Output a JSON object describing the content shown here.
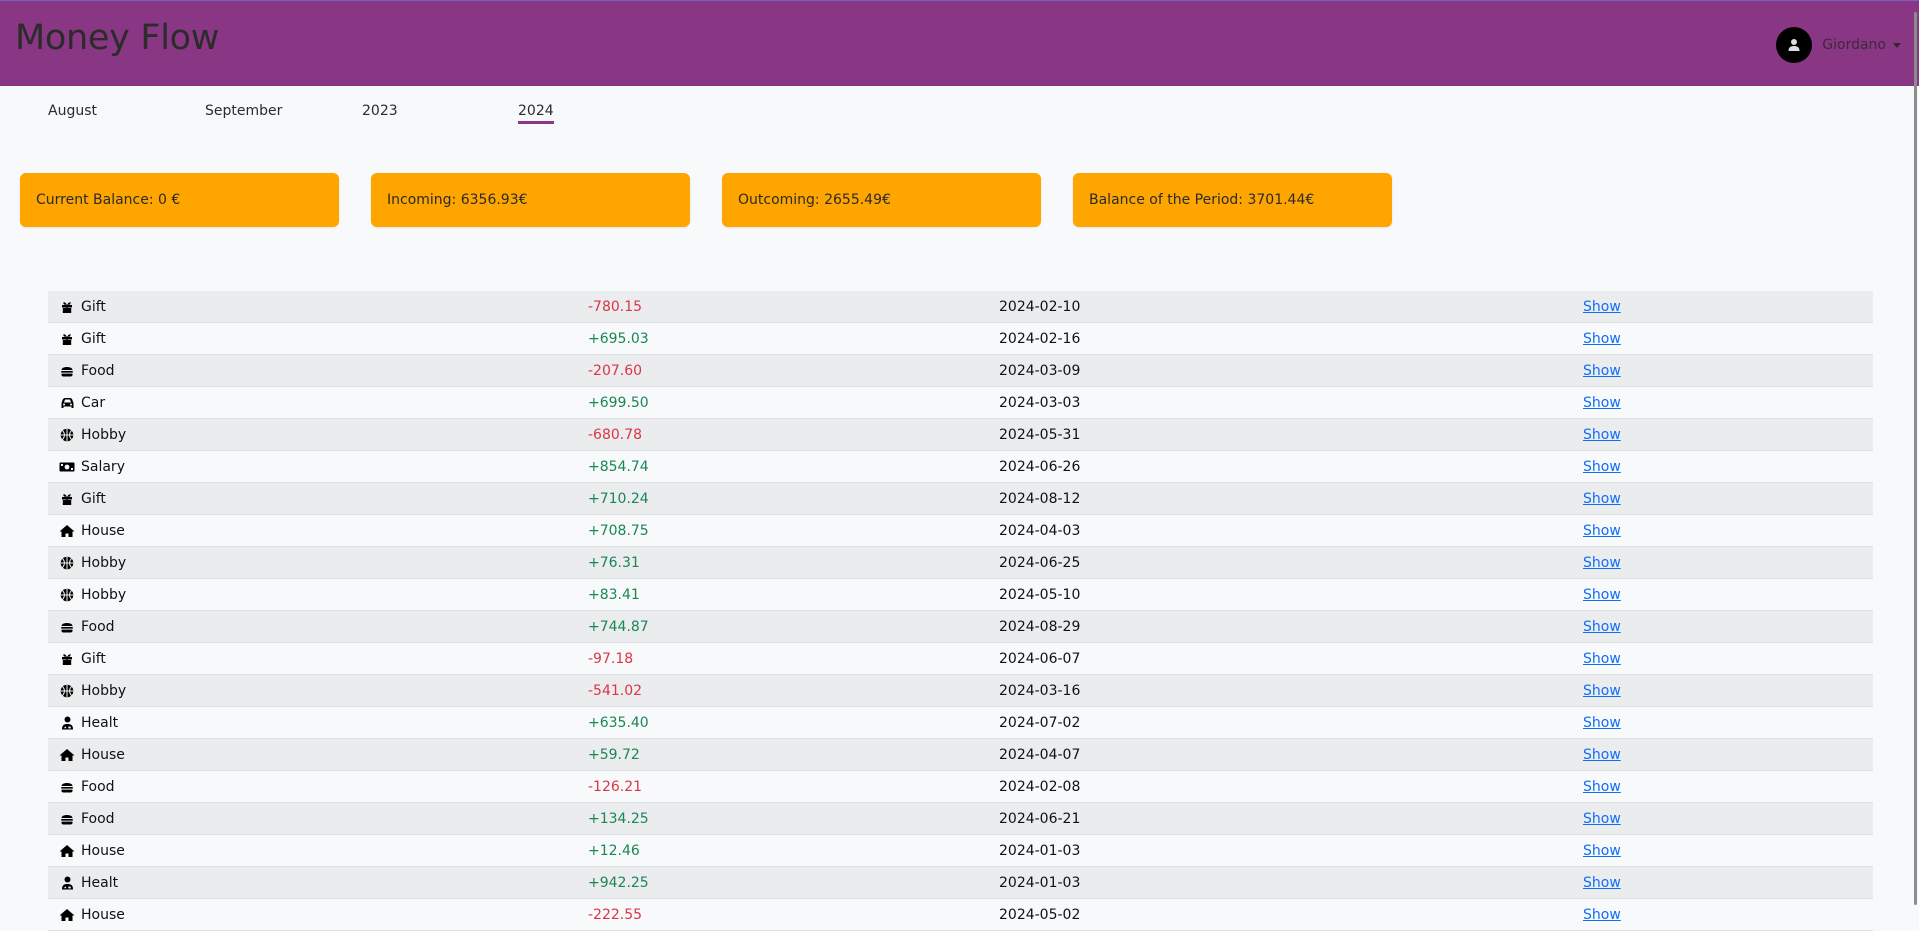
{
  "app": {
    "title": "Money Flow",
    "user": {
      "name": "Giordano",
      "avatar_icon": "user-icon"
    },
    "colors": {
      "navbar": "#893785",
      "card": "#ffa500",
      "negative": "#dc3545",
      "positive": "#198754",
      "link": "#0d6efd"
    }
  },
  "tabs": [
    {
      "label": "August",
      "active": false
    },
    {
      "label": "September",
      "active": false
    },
    {
      "label": "2023",
      "active": false
    },
    {
      "label": "2024",
      "active": true
    }
  ],
  "summary": [
    {
      "label": "Current Balance: 0 €"
    },
    {
      "label": "Incoming: 6356.93€"
    },
    {
      "label": "Outcoming: 2655.49€"
    },
    {
      "label": "Balance of the Period: 3701.44€"
    }
  ],
  "transactions": [
    {
      "category": "Gift",
      "icon": "gift-icon",
      "amount": "-780.15",
      "sign": "neg",
      "date": "2024-02-10",
      "action": "Show"
    },
    {
      "category": "Gift",
      "icon": "gift-icon",
      "amount": "+695.03",
      "sign": "pos",
      "date": "2024-02-16",
      "action": "Show"
    },
    {
      "category": "Food",
      "icon": "burger-icon",
      "amount": "-207.60",
      "sign": "neg",
      "date": "2024-03-09",
      "action": "Show"
    },
    {
      "category": "Car",
      "icon": "car-icon",
      "amount": "+699.50",
      "sign": "pos",
      "date": "2024-03-03",
      "action": "Show"
    },
    {
      "category": "Hobby",
      "icon": "basketball-icon",
      "amount": "-680.78",
      "sign": "neg",
      "date": "2024-05-31",
      "action": "Show"
    },
    {
      "category": "Salary",
      "icon": "money-bill-icon",
      "amount": "+854.74",
      "sign": "pos",
      "date": "2024-06-26",
      "action": "Show"
    },
    {
      "category": "Gift",
      "icon": "gift-icon",
      "amount": "+710.24",
      "sign": "pos",
      "date": "2024-08-12",
      "action": "Show"
    },
    {
      "category": "House",
      "icon": "house-icon",
      "amount": "+708.75",
      "sign": "pos",
      "date": "2024-04-03",
      "action": "Show"
    },
    {
      "category": "Hobby",
      "icon": "basketball-icon",
      "amount": "+76.31",
      "sign": "pos",
      "date": "2024-06-25",
      "action": "Show"
    },
    {
      "category": "Hobby",
      "icon": "basketball-icon",
      "amount": "+83.41",
      "sign": "pos",
      "date": "2024-05-10",
      "action": "Show"
    },
    {
      "category": "Food",
      "icon": "burger-icon",
      "amount": "+744.87",
      "sign": "pos",
      "date": "2024-08-29",
      "action": "Show"
    },
    {
      "category": "Gift",
      "icon": "gift-icon",
      "amount": "-97.18",
      "sign": "neg",
      "date": "2024-06-07",
      "action": "Show"
    },
    {
      "category": "Hobby",
      "icon": "basketball-icon",
      "amount": "-541.02",
      "sign": "neg",
      "date": "2024-03-16",
      "action": "Show"
    },
    {
      "category": "Healt",
      "icon": "doctor-icon",
      "amount": "+635.40",
      "sign": "pos",
      "date": "2024-07-02",
      "action": "Show"
    },
    {
      "category": "House",
      "icon": "house-icon",
      "amount": "+59.72",
      "sign": "pos",
      "date": "2024-04-07",
      "action": "Show"
    },
    {
      "category": "Food",
      "icon": "burger-icon",
      "amount": "-126.21",
      "sign": "neg",
      "date": "2024-02-08",
      "action": "Show"
    },
    {
      "category": "Food",
      "icon": "burger-icon",
      "amount": "+134.25",
      "sign": "pos",
      "date": "2024-06-21",
      "action": "Show"
    },
    {
      "category": "House",
      "icon": "house-icon",
      "amount": "+12.46",
      "sign": "pos",
      "date": "2024-01-03",
      "action": "Show"
    },
    {
      "category": "Healt",
      "icon": "doctor-icon",
      "amount": "+942.25",
      "sign": "pos",
      "date": "2024-01-03",
      "action": "Show"
    },
    {
      "category": "House",
      "icon": "house-icon",
      "amount": "-222.55",
      "sign": "neg",
      "date": "2024-05-02",
      "action": "Show"
    }
  ]
}
